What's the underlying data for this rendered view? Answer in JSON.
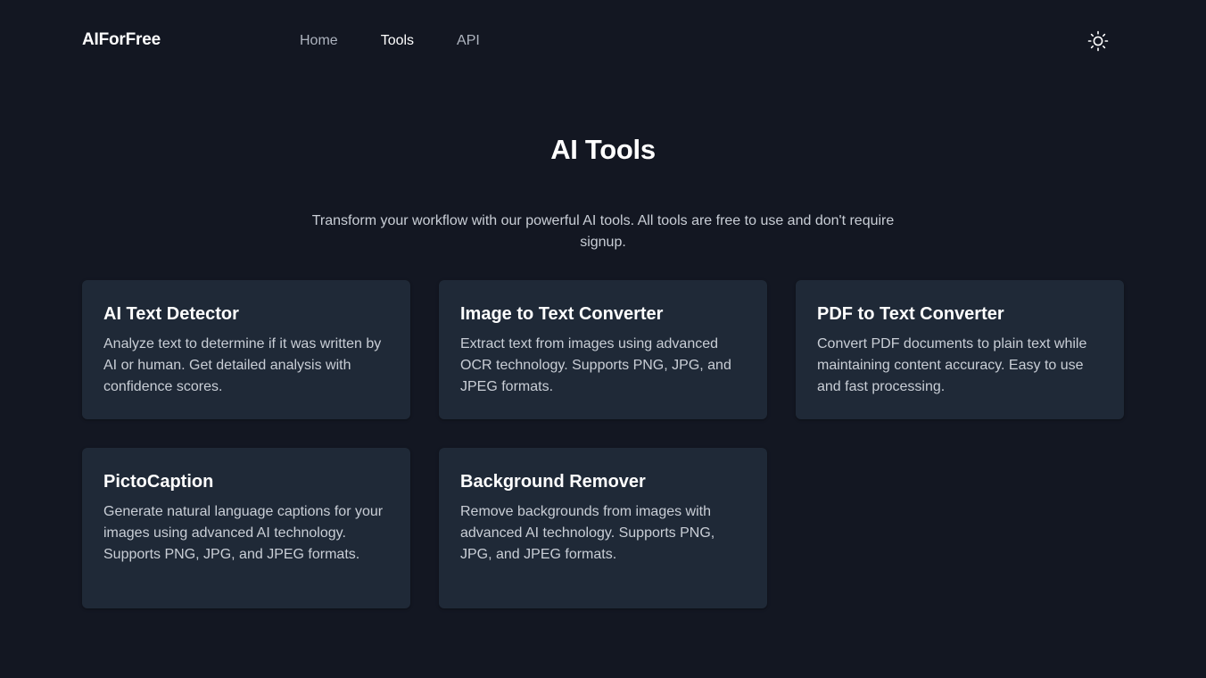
{
  "header": {
    "brand": "AIForFree",
    "nav": [
      {
        "label": "Home",
        "active": false
      },
      {
        "label": "Tools",
        "active": true
      },
      {
        "label": "API",
        "active": false
      }
    ],
    "theme_toggle_icon": "sun-icon"
  },
  "hero": {
    "title": "AI Tools",
    "subtitle": "Transform your workflow with our powerful AI tools. All tools are free to use and don't require signup."
  },
  "tools": [
    {
      "title": "AI Text Detector",
      "description": "Analyze text to determine if it was written by AI or human. Get detailed analysis with confidence scores."
    },
    {
      "title": "Image to Text Converter",
      "description": "Extract text from images using advanced OCR technology. Supports PNG, JPG, and JPEG formats."
    },
    {
      "title": "PDF to Text Converter",
      "description": "Convert PDF documents to plain text while maintaining content accuracy. Easy to use and fast processing."
    },
    {
      "title": "PictoCaption",
      "description": "Generate natural language captions for your images using advanced AI technology. Supports PNG, JPG, and JPEG formats."
    },
    {
      "title": "Background Remover",
      "description": "Remove backgrounds from images with advanced AI technology. Supports PNG, JPG, and JPEG formats."
    }
  ],
  "colors": {
    "background": "#131722",
    "card": "#1f2937",
    "text_primary": "#ffffff",
    "text_secondary": "#c9ced6",
    "nav_inactive": "#aeb4bf"
  }
}
